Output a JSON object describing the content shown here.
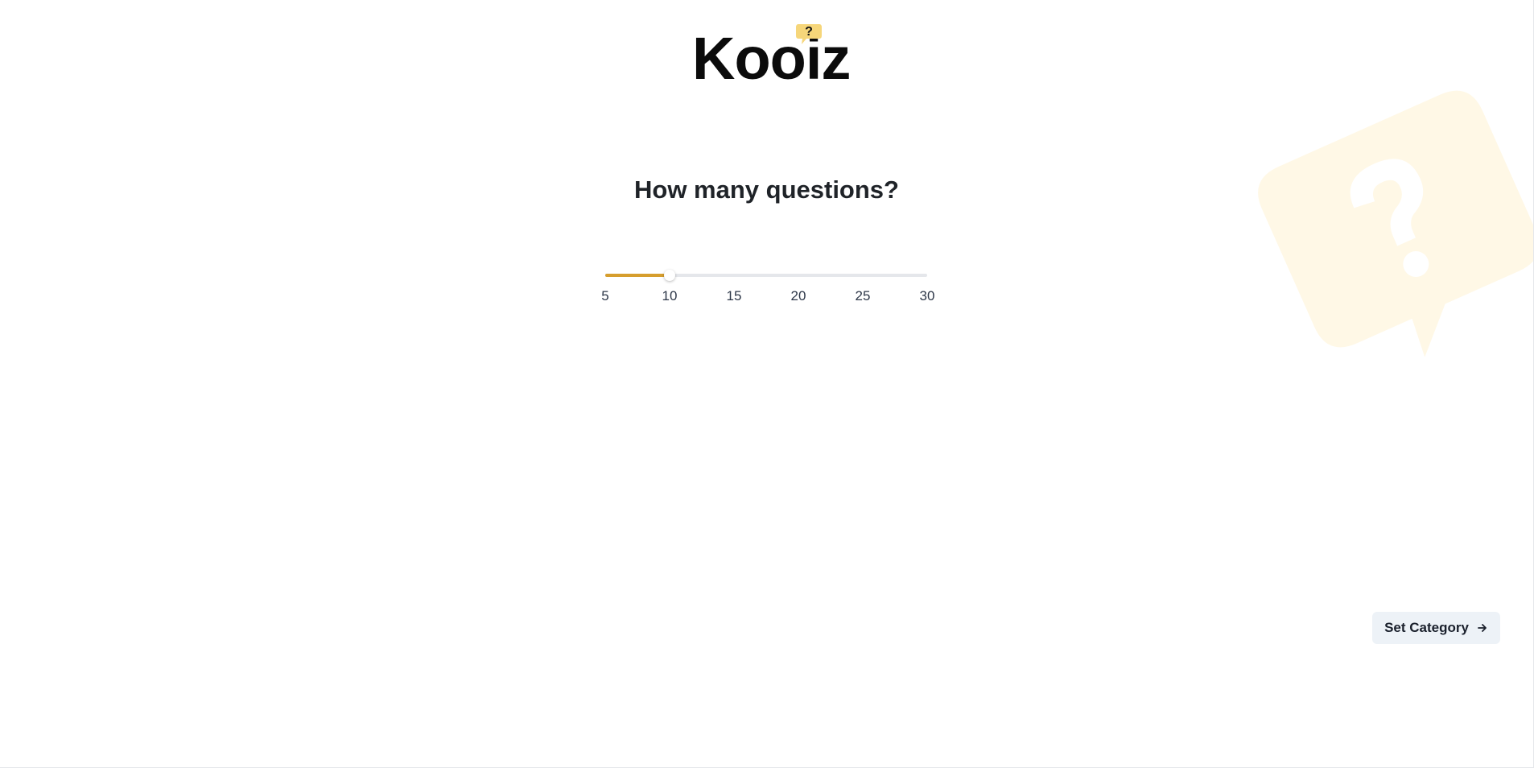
{
  "brand": {
    "name": "Kooiz",
    "bubble_glyph": "?",
    "bubble_color": "#f6d67a"
  },
  "heading": "How many questions?",
  "slider": {
    "min": 5,
    "max": 30,
    "value": 10,
    "fill_color": "#d69e2e",
    "tick_labels": [
      "5",
      "10",
      "15",
      "20",
      "25",
      "30"
    ]
  },
  "decoration": {
    "icon": "question-bubble-icon",
    "color": "#fff8e6"
  },
  "actions": {
    "set_category_label": "Set Category",
    "set_category_icon": "arrow-right-icon"
  }
}
